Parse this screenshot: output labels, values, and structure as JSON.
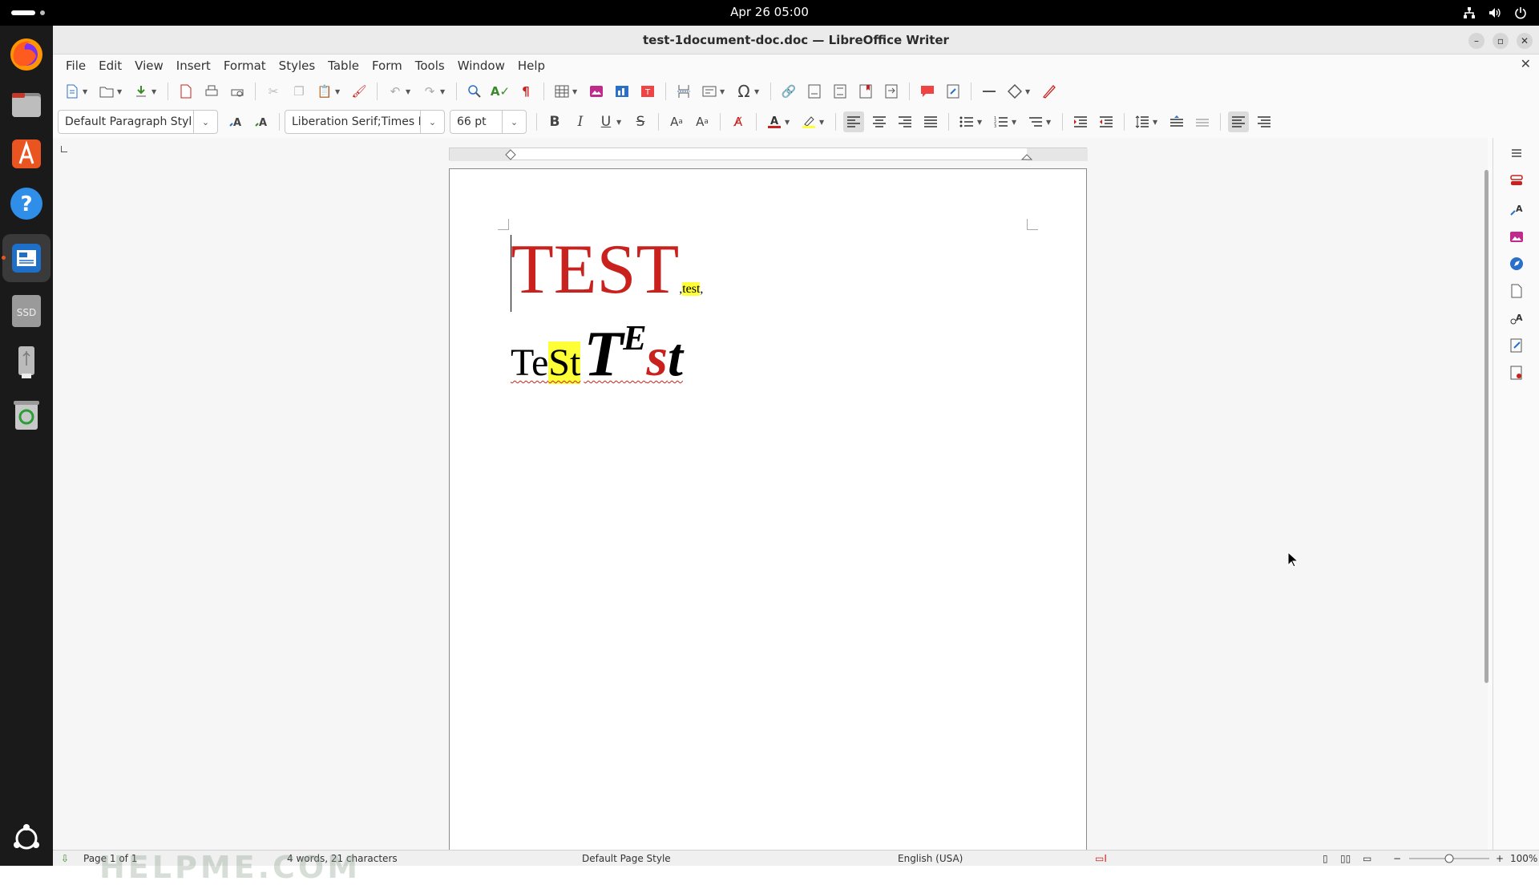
{
  "system": {
    "clock": "Apr 26  05:00"
  },
  "window": {
    "title": "test-1document-doc.doc — LibreOffice Writer"
  },
  "menu": [
    "File",
    "Edit",
    "View",
    "Insert",
    "Format",
    "Styles",
    "Table",
    "Form",
    "Tools",
    "Window",
    "Help"
  ],
  "toolbar": {
    "paragraph_style": "Default Paragraph Styl",
    "font_name": "Liberation Serif;Times Ne",
    "font_size": "66 pt"
  },
  "document": {
    "line1_big": "TEST",
    "line1_small_pre": ",",
    "line1_small_hl": "test",
    "line1_small_post": ",",
    "line2": {
      "w_te": "Te",
      "w_st": "St",
      "w_T": "T",
      "w_E": "E",
      "w_s": "s",
      "w_t": "t"
    }
  },
  "statusbar": {
    "page": "Page 1 of 1",
    "words": "4 words, 21 characters",
    "page_style": "Default Page Style",
    "language": "English (USA)",
    "zoom": "100%"
  },
  "watermark": "HELPME.COM",
  "colors": {
    "accent_red": "#c9211e",
    "highlight_yellow": "#ffff38"
  }
}
